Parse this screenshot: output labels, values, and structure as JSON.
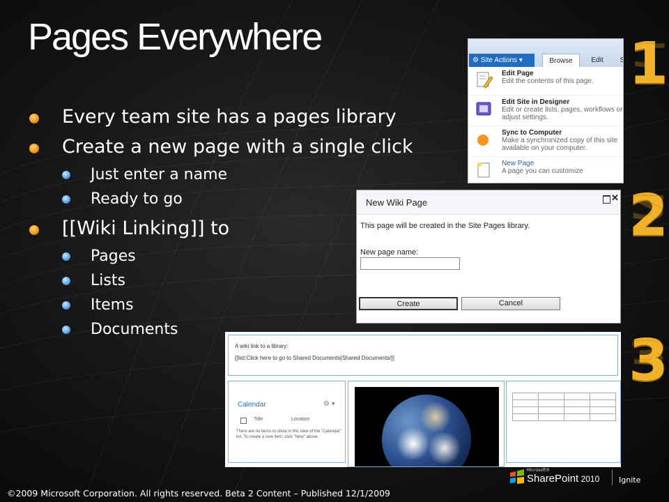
{
  "slide": {
    "title": "Pages Everywhere",
    "bullets": {
      "b1": "Every team site has a pages library",
      "b2": "Create a new page with a single click",
      "b2_sub": [
        "Just enter a name",
        "Ready to go"
      ],
      "b3": "[[Wiki Linking]] to",
      "b3_sub": [
        "Pages",
        "Lists",
        "Items",
        "Documents"
      ]
    },
    "step_numbers": [
      "1",
      "2",
      "3"
    ]
  },
  "site_actions_menu": {
    "button_label": "Site Actions",
    "tabs": [
      "Browse",
      "Edit",
      "S"
    ],
    "items": [
      {
        "title": "Edit Page",
        "desc": "Edit the contents of this page."
      },
      {
        "title": "Edit Site in Designer",
        "desc": "Edit or create lists, pages, workflows or adjust settings."
      },
      {
        "title": "Sync to Computer",
        "desc": "Make a synchronized copy of this site available on your computer."
      },
      {
        "title": "New Page",
        "desc": "A page you can customize"
      }
    ]
  },
  "new_wiki_dialog": {
    "title": "New Wiki Page",
    "message": "This page will be created in the Site Pages library.",
    "name_label": "New page name:",
    "name_value": "",
    "create_label": "Create",
    "cancel_label": "Cancel"
  },
  "wiki_preview": {
    "line1": "A wiki link to a library:",
    "line2": "[[list:Click here to go to Shared Documents|Shared Documents/]]",
    "calendar": {
      "title": "Calendar",
      "col_title": "Title",
      "col_location": "Location",
      "empty_message": "There are no items to show in this view of the \"Calendar\" list. To create a new item, click \"New\" above."
    }
  },
  "footer": {
    "copyright": "©2009 Microsoft Corporation. All rights reserved. Beta 2 Content – Published 12/1/2009",
    "logo_microsoft": "Microsoft®",
    "logo_product": "SharePoint",
    "logo_version": "2010",
    "logo_ignite": "Ignite"
  },
  "colors": {
    "accent_orange": "#f1b22a",
    "site_actions_blue": "#1f6cc1",
    "link_blue": "#2870b8"
  }
}
